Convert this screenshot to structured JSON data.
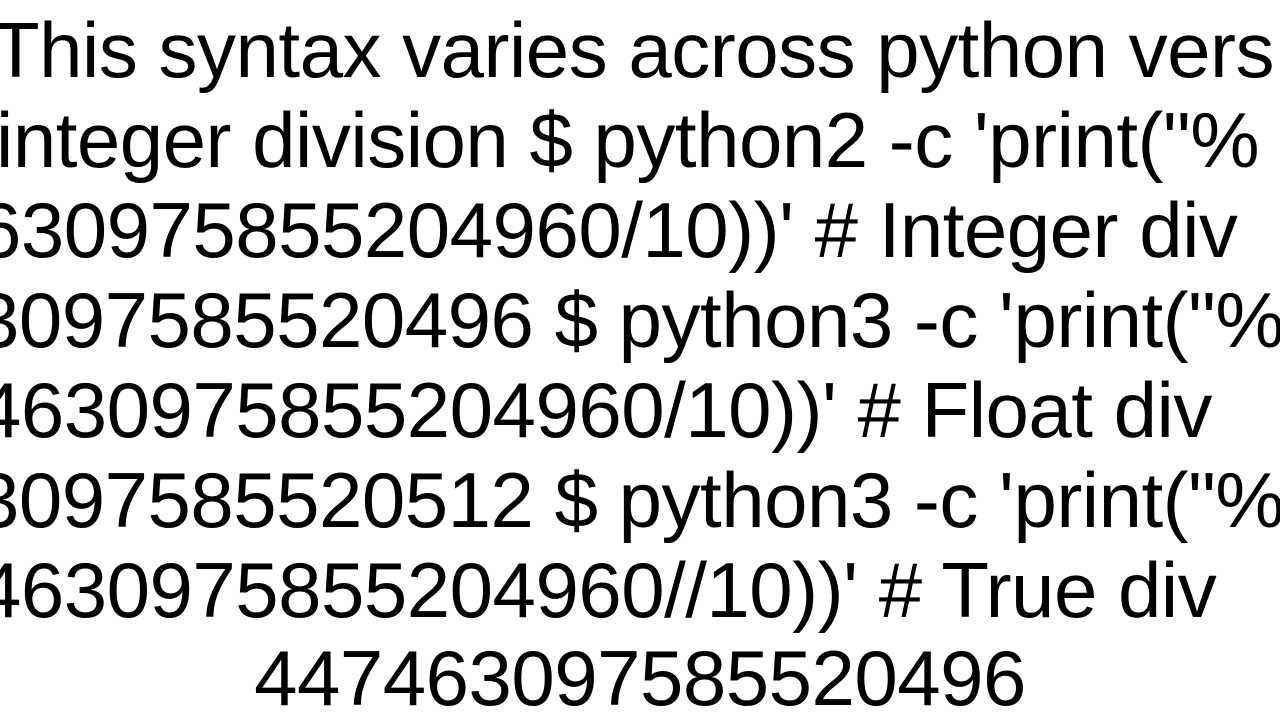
{
  "lines": {
    "l1": "This syntax varies across python vers",
    "l2": " integer division $ python2 -c 'print(\"%",
    "l3": "630975855204960/10))'  # Integer div",
    "l4": "3097585520496 $ python3 -c 'print(\"%",
    "l5": "4630975855204960/10))'  # Float div",
    "l6": "3097585520512 $ python3 -c 'print(\"%",
    "l7": "4630975855204960//10))'  # True div",
    "l8": "447463097585520496"
  }
}
